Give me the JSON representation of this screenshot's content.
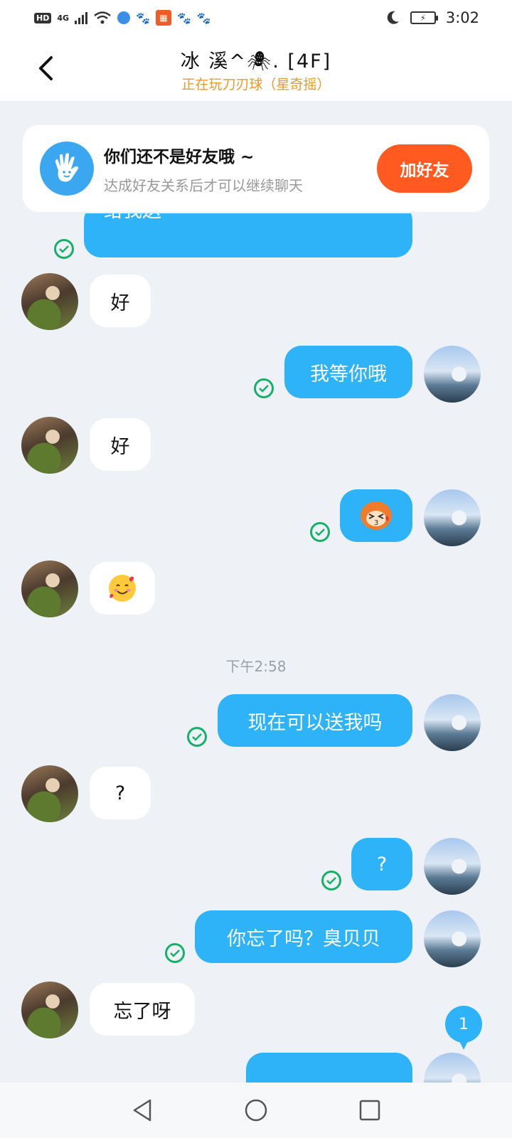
{
  "status_bar": {
    "hd": "HD",
    "network": "4G",
    "time": "3:02"
  },
  "header": {
    "title": "冰 溪^🕷. [4F]",
    "subtitle": "正在玩刀刃球（星奇摇）"
  },
  "friend_card": {
    "title": "你们还不是好友哦 ~",
    "subtitle": "达成好友关系后才可以继续聊天",
    "button": "加好友"
  },
  "messages": [
    {
      "from": "me",
      "text": "给我送",
      "partial": true
    },
    {
      "from": "them",
      "text": "好"
    },
    {
      "from": "me",
      "text": "我等你哦"
    },
    {
      "from": "them",
      "text": "好"
    },
    {
      "from": "me",
      "type": "sticker",
      "text": ""
    },
    {
      "from": "them",
      "type": "emoji",
      "text": ""
    },
    {
      "from": "me",
      "text": "现在可以送我吗"
    },
    {
      "from": "them",
      "text": "?"
    },
    {
      "from": "me",
      "text": "?"
    },
    {
      "from": "me",
      "text": "你忘了吗？臭贝贝"
    },
    {
      "from": "them",
      "text": "忘了呀"
    }
  ],
  "timestamp": "下午2:58",
  "unread_badge": "1",
  "icons": {
    "back": "back-arrow-icon",
    "hand": "hand-wave-icon",
    "check": "read-check-icon",
    "nav_back": "triangle-back-icon",
    "nav_home": "circle-home-icon",
    "nav_recent": "square-recent-icon"
  },
  "colors": {
    "my_bubble": "#2eb3f8",
    "their_bubble": "#ffffff",
    "add_button": "#ff5a1f",
    "subtitle": "#e89a2a",
    "check": "#16b06a",
    "background": "#eef2f7"
  }
}
